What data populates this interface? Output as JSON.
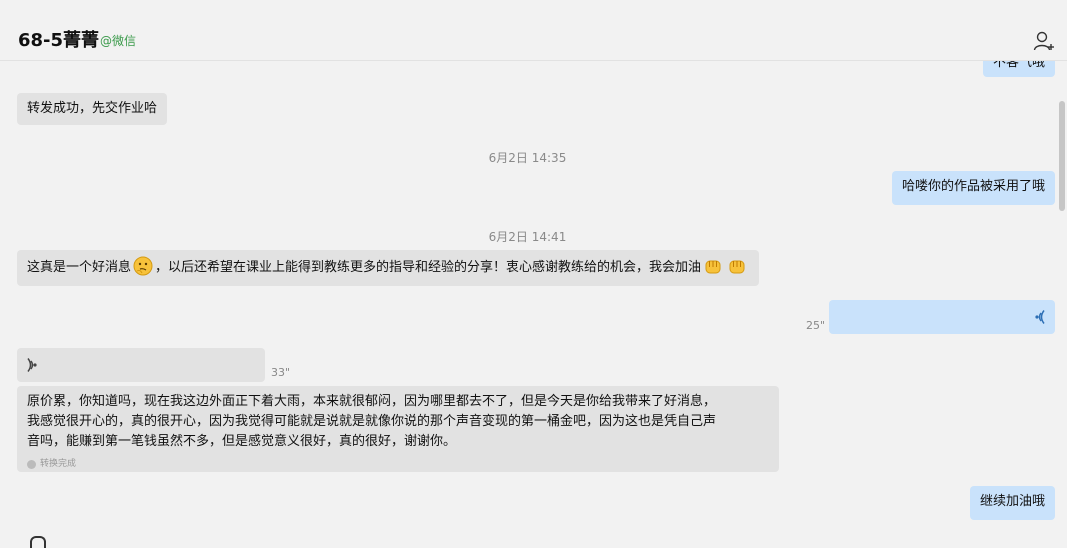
{
  "window": {
    "minimize_icon": "minimize-icon",
    "restore_icon": "restore-icon",
    "close_icon": "close-icon"
  },
  "header": {
    "title": "68-5菁菁",
    "tag": "@微信",
    "add_user_icon": "add-user-icon"
  },
  "messages": {
    "partial_top": "不客气哦",
    "m1": "转发成功，先交作业哈",
    "ts1": "6月2日 14:35",
    "m2": "哈喽你的作品被采用了哦",
    "ts2": "6月2日 14:41",
    "m3_a": "这真是一个好消息",
    "m3_b": "，以后还希望在课业上能得到教练更多的指导和经验的分享！衷心感谢教练给的机会，我会加油",
    "voice_out_duration": "25\"",
    "voice_in_duration": "33\"",
    "transcript_line1": "原价累，你知道吗，现在我这边外面正下着大雨，本来就很郁闷，因为哪里都去不了，但是今天是你给我带来了好消息，",
    "transcript_line2": "我感觉很开心的，真的很开心，因为我觉得可能就是说就是就像你说的那个声音变现的第一桶金吧，因为这也是凭自己声",
    "transcript_line3": "音吗，能赚到第一笔钱虽然不多，但是感觉意义很好，真的很好，谢谢你。",
    "transcript_status": "转换完成",
    "m5": "继续加油哦"
  },
  "colors": {
    "incoming": "#e2e2e2",
    "outgoing": "#c9e2fb",
    "tag_green": "#3a9a4a"
  }
}
